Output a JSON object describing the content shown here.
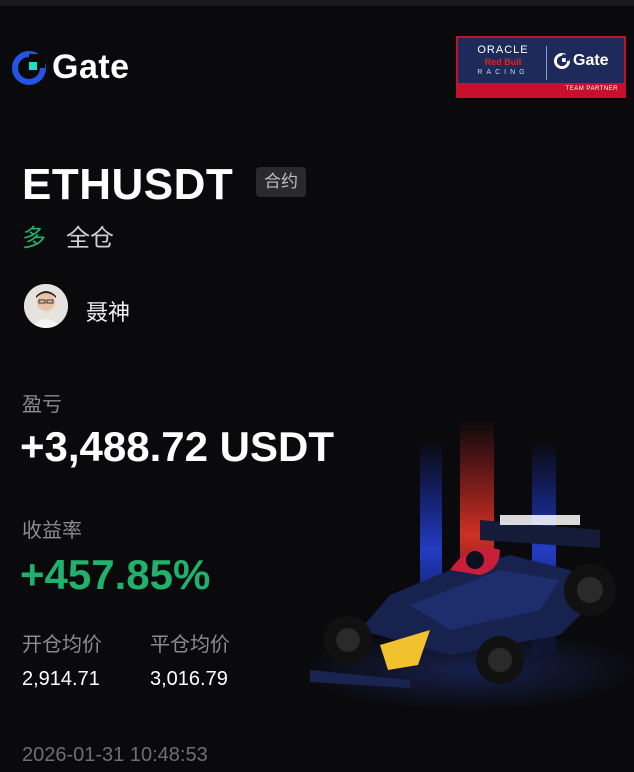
{
  "brand": {
    "logo_text": "Gate"
  },
  "partner": {
    "oracle": "ORACLE",
    "redbull": "Red Bull",
    "racing": "RACING",
    "gate": "Gate",
    "footer": "TEAM PARTNER"
  },
  "position": {
    "pair": "ETHUSDT",
    "type": "合约",
    "side": "多",
    "margin_mode": "全仓"
  },
  "user": {
    "name": "聂神"
  },
  "pnl": {
    "label": "盈亏",
    "value": "+3,488.72 USDT"
  },
  "roi": {
    "label": "收益率",
    "value": "+457.85%"
  },
  "prices": {
    "open_label": "开仓均价",
    "close_label": "平仓均价",
    "open_value": "2,914.71",
    "close_value": "3,016.79"
  },
  "timestamp": "2026-01-31 10:48:53",
  "colors": {
    "profit_green": "#20b26c",
    "gate_blue": "#2354e6",
    "background": "#0a0a0c"
  },
  "icons": {
    "logo": "gate-logo-icon",
    "car": "f1-car-illustration",
    "avatar": "user-avatar"
  }
}
